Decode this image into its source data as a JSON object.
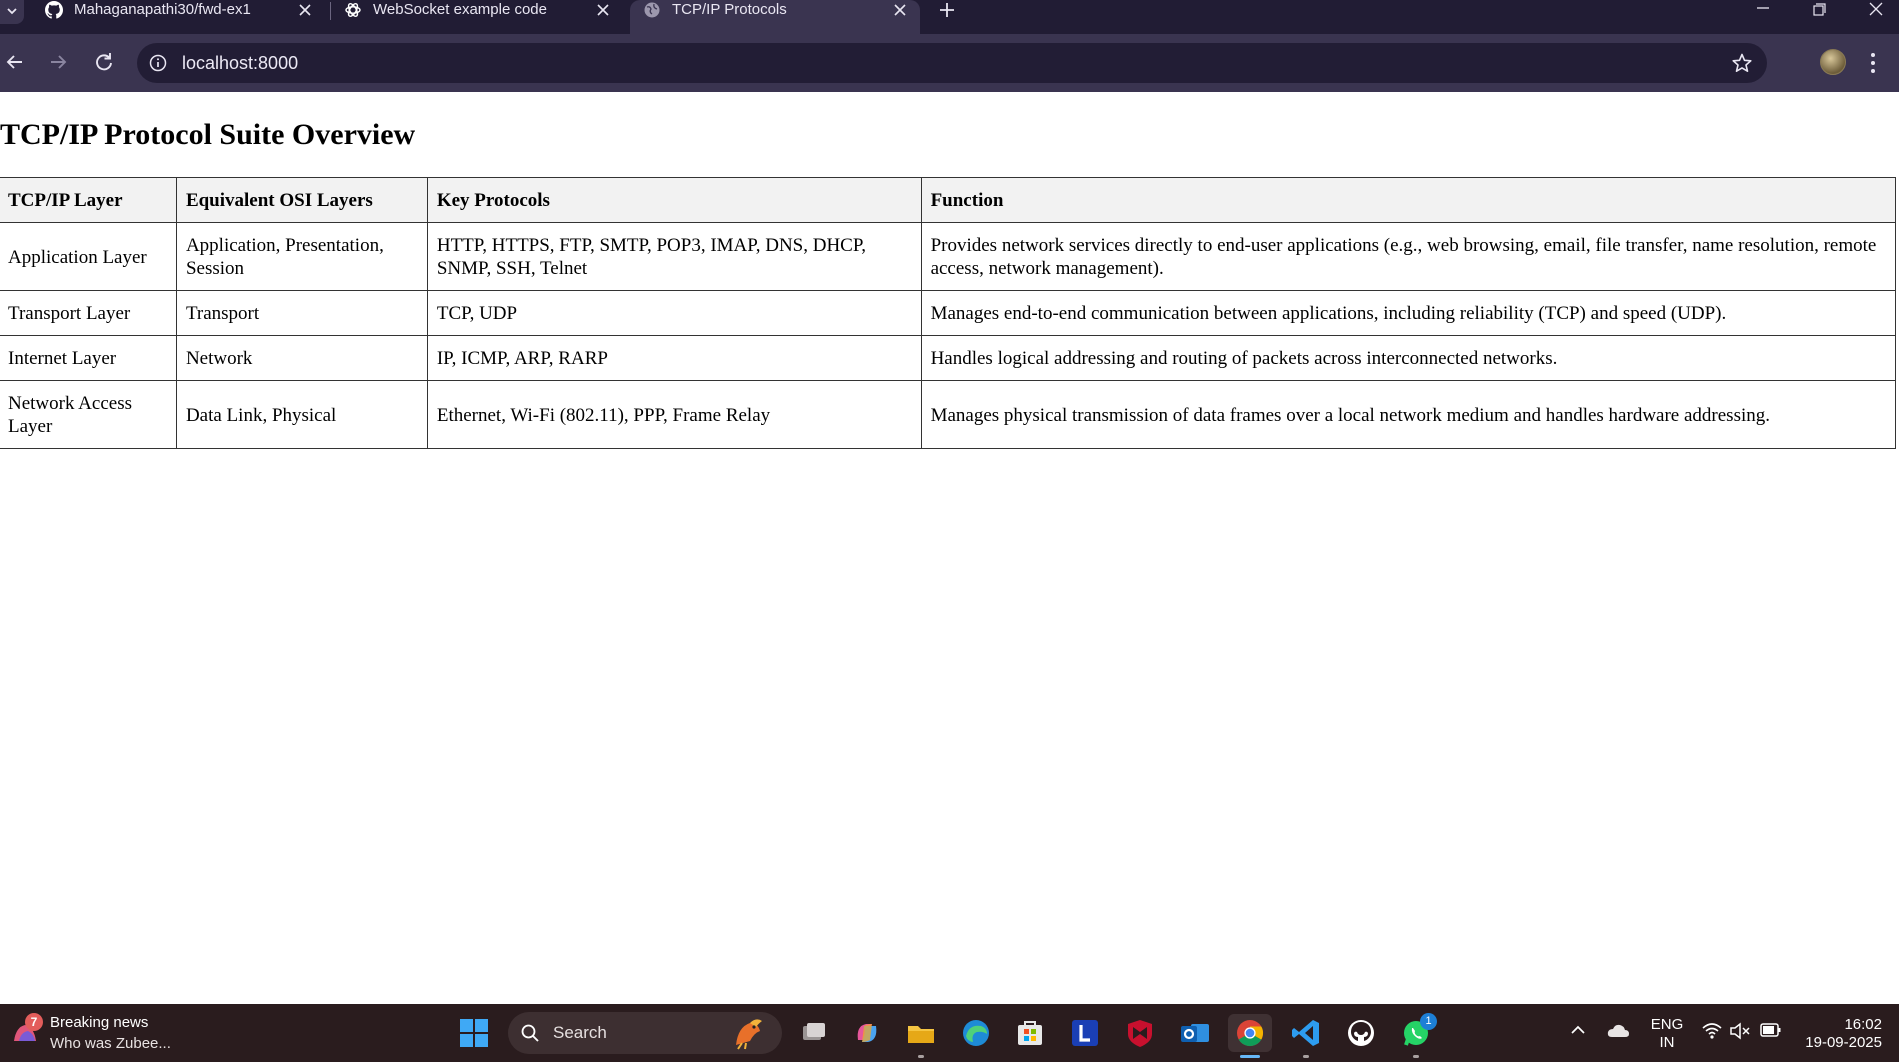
{
  "browser": {
    "tabs": [
      {
        "title": "Mahaganapathi30/fwd-ex1",
        "icon": "github-icon"
      },
      {
        "title": "WebSocket example code",
        "icon": "chatgpt-icon"
      },
      {
        "title": "TCP/IP Protocols",
        "icon": "globe-icon",
        "active": true
      }
    ],
    "url": "localhost:8000"
  },
  "page": {
    "heading": "TCP/IP Protocol Suite Overview",
    "table": {
      "headers": [
        "TCP/IP Layer",
        "Equivalent OSI Layers",
        "Key Protocols",
        "Function"
      ],
      "rows": [
        [
          "Application Layer",
          "Application, Presentation, Session",
          "HTTP, HTTPS, FTP, SMTP, POP3, IMAP, DNS, DHCP, SNMP, SSH, Telnet",
          "Provides network services directly to end-user applications (e.g., web browsing, email, file transfer, name resolution, remote access, network management)."
        ],
        [
          "Transport Layer",
          "Transport",
          "TCP, UDP",
          "Manages end-to-end communication between applications, including reliability (TCP) and speed (UDP)."
        ],
        [
          "Internet Layer",
          "Network",
          "IP, ICMP, ARP, RARP",
          "Handles logical addressing and routing of packets across interconnected networks."
        ],
        [
          "Network Access Layer",
          "Data Link, Physical",
          "Ethernet, Wi-Fi (802.11), PPP, Frame Relay",
          "Manages physical transmission of data frames over a local network medium and handles hardware addressing."
        ]
      ]
    }
  },
  "taskbar": {
    "news_badge": "7",
    "news_title": "Breaking news",
    "news_subtitle": "Who was Zubee...",
    "search_placeholder": "Search",
    "whatsapp_badge": "1",
    "language": "ENG",
    "region": "IN",
    "time": "16:02",
    "date": "19-09-2025"
  },
  "colors": {
    "tabstrip": "#211c34",
    "toolbar": "#3a3450",
    "taskbar": "#2a1c1e",
    "table_header_bg": "#f2f2f2"
  }
}
